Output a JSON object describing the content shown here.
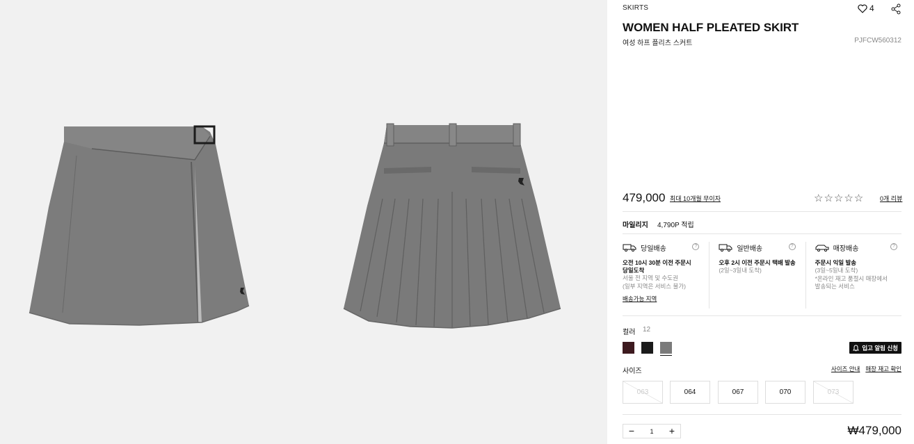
{
  "product": {
    "category": "SKIRTS",
    "wishlist_count": "4",
    "title": "WOMEN HALF PLEATED SKIRT",
    "subtitle": "여성 하프 플리츠 스커트",
    "code": "PJFCW560312",
    "price": "479,000",
    "installment_link": "최대 10개월 무이자",
    "rating_stars": "☆☆☆☆☆",
    "review_link": "0개 리뷰"
  },
  "mileage": {
    "label": "마일리지",
    "value": "4,790P 적립"
  },
  "delivery": {
    "options": [
      {
        "name": "당일배송",
        "title": "오전 10시 30분 이전 주문시\n당일도착",
        "notes": [
          "서울 전 지역 및 수도권",
          "(일부 지역은 서비스 불가)"
        ]
      },
      {
        "name": "일반배송",
        "title": "오후 2시 이전 주문시 택배 발송",
        "notes": [
          "(2일~3일내 도착)"
        ]
      },
      {
        "name": "매장배송",
        "title": "주문시 익일 발송",
        "notes": [
          "(3일~5일내 도착)",
          "*온라인 재고 품절시 매장에서",
          "발송되는 서비스"
        ]
      }
    ],
    "area_link": "배송가능 지역"
  },
  "color": {
    "label": "컬러",
    "count": "12",
    "swatches": [
      {
        "name": "burgundy",
        "hex": "#3d1a1f"
      },
      {
        "name": "black",
        "hex": "#1b1b1b"
      },
      {
        "name": "gray",
        "hex": "#7b7b7b",
        "selected": true
      }
    ],
    "notify_label": "입고 알림 신청"
  },
  "size": {
    "label": "사이즈",
    "guide_link": "사이즈 안내",
    "stock_link": "매장 재고 확인",
    "options": [
      {
        "value": "063",
        "available": false
      },
      {
        "value": "064",
        "available": true
      },
      {
        "value": "067",
        "available": true
      },
      {
        "value": "070",
        "available": true
      },
      {
        "value": "073",
        "available": false
      }
    ]
  },
  "quantity": {
    "minus": "−",
    "value": "1",
    "plus": "+"
  },
  "total_price": "₩479,000",
  "colors": {
    "skirt": "#7a7a7a",
    "skirt_dark": "#5e5e5e",
    "background": "#f1f1f1"
  }
}
